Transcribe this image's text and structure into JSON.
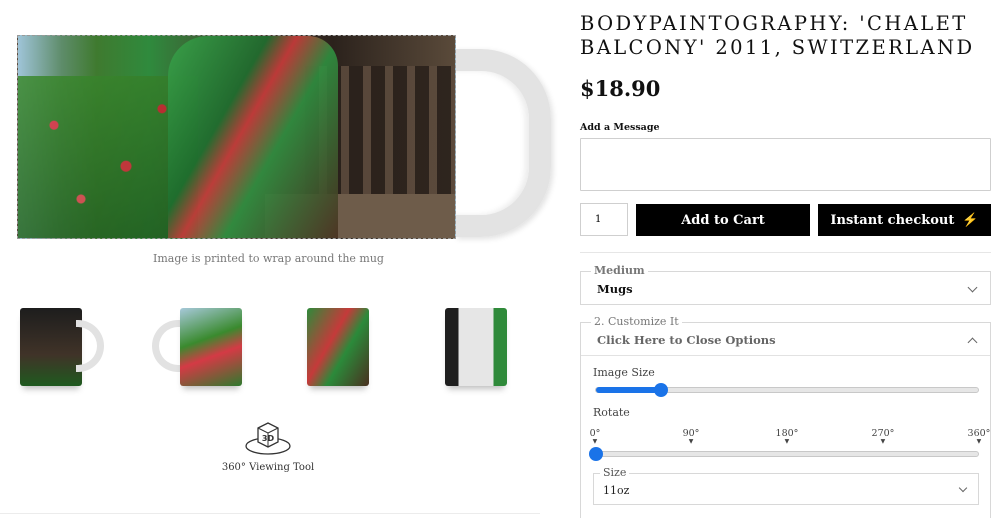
{
  "preview": {
    "wrap_note": "Image is printed to wrap around the mug",
    "viewer_label": "360° Viewing Tool",
    "viewer_icon": "3d-cube-icon",
    "viewer_icon_text": "3D"
  },
  "product": {
    "title": "BODYPAINTOGRAPHY: 'CHALET BALCONY' 2011, SWITZERLAND",
    "price": "$18.90"
  },
  "message": {
    "label": "Add a Message",
    "value": ""
  },
  "cart": {
    "quantity": "1",
    "add_to_cart_label": "Add to Cart",
    "instant_checkout_label": "Instant checkout",
    "instant_icon": "lightning-bolt-icon",
    "bolt_glyph": "⚡"
  },
  "medium": {
    "legend": "Medium",
    "selected": "Mugs"
  },
  "customize": {
    "legend": "2. Customize It",
    "toggle_label": "Click Here to Close Options",
    "image_size_label": "Image Size",
    "image_size_fraction": 0.17,
    "rotate_label": "Rotate",
    "rotate_ticks": [
      "0°",
      "90°",
      "180°",
      "270°",
      "360°"
    ],
    "rotate_value_deg": 0,
    "size_legend": "Size",
    "size_selected": "11oz"
  },
  "colors": {
    "accent": "#1a73e8",
    "button_bg": "#000000",
    "button_text": "#ffffff"
  }
}
